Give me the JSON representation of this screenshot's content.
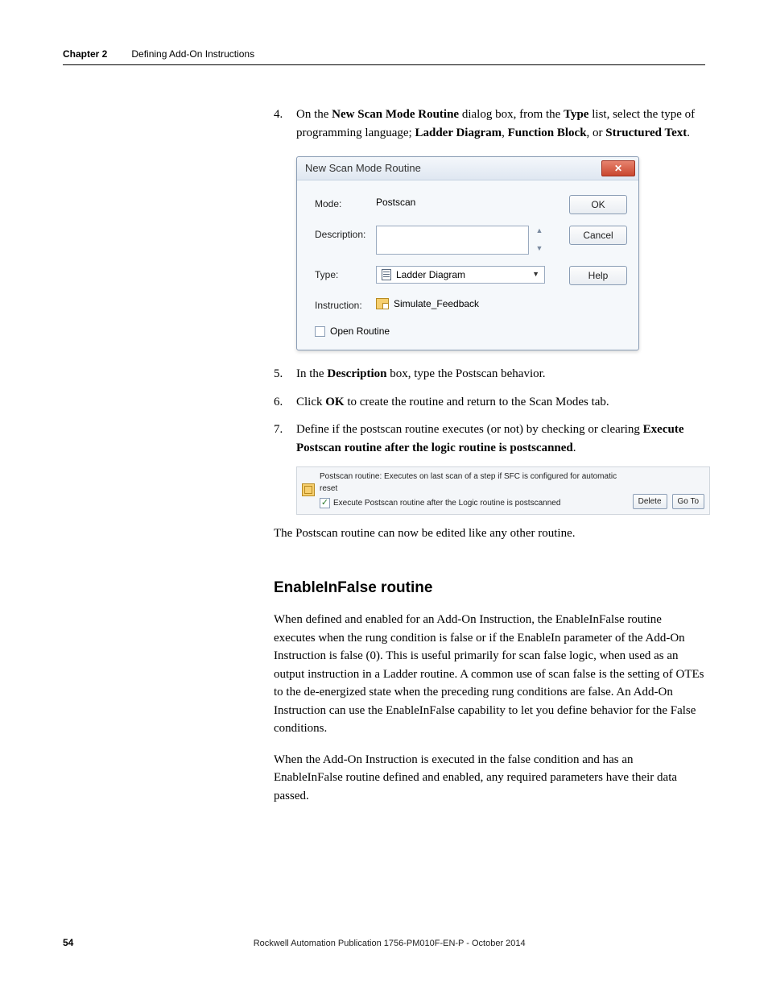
{
  "header": {
    "chapter_label": "Chapter 2",
    "chapter_title": "Defining Add-On Instructions"
  },
  "steps": {
    "s4": {
      "num": "4.",
      "pre": "On the ",
      "b1": "New Scan Mode Routine",
      "mid1": " dialog box, from the ",
      "b2": "Type",
      "mid2": " list, select the type of programming language; ",
      "b3": "Ladder Diagram",
      "sep1": ", ",
      "b4": "Function Block",
      "sep2": ", or ",
      "b5": "Structured Text",
      "end": "."
    },
    "s5": {
      "num": "5.",
      "pre": "In the ",
      "b1": "Description",
      "post": " box, type the Postscan behavior."
    },
    "s6": {
      "num": "6.",
      "pre": "Click ",
      "b1": "OK",
      "post": " to create the routine and return to the Scan Modes tab."
    },
    "s7": {
      "num": "7.",
      "pre": "Define if the postscan routine executes (or not) by checking or clearing ",
      "b1": "Execute Postscan routine after the logic routine is postscanned",
      "post": "."
    }
  },
  "dialog": {
    "title": "New Scan Mode Routine",
    "close": "✕",
    "mode_label": "Mode:",
    "mode_value": "Postscan",
    "desc_label": "Description:",
    "desc_value": "",
    "type_label": "Type:",
    "type_value": "Ladder Diagram",
    "instr_label": "Instruction:",
    "instr_value": "Simulate_Feedback",
    "open_routine_label": "Open Routine",
    "ok": "OK",
    "cancel": "Cancel",
    "help": "Help"
  },
  "snippet": {
    "line1": "Postscan routine: Executes on last scan of a step if SFC is configured for automatic reset",
    "line2": "Execute Postscan routine after the Logic routine is postscanned",
    "delete": "Delete",
    "goto": "Go To"
  },
  "para_after_snippet": "The Postscan routine can now be edited like any other routine.",
  "section": {
    "heading": "EnableInFalse routine",
    "p1": "When defined and enabled for an Add-On Instruction, the EnableInFalse routine executes when the rung condition is false or if the EnableIn parameter of the Add-On Instruction is false (0). This is useful primarily for scan false logic, when used as an output instruction in a Ladder routine. A common use of scan false is the setting of OTEs to the de-energized state when the preceding rung conditions are false. An Add-On Instruction can use the EnableInFalse capability to let you define behavior for the False conditions.",
    "p2": "When the Add-On Instruction is executed in the false condition and has an EnableInFalse routine defined and enabled, any required parameters have their data passed."
  },
  "footer": {
    "page": "54",
    "publication": "Rockwell Automation Publication 1756-PM010F-EN-P - October 2014"
  }
}
